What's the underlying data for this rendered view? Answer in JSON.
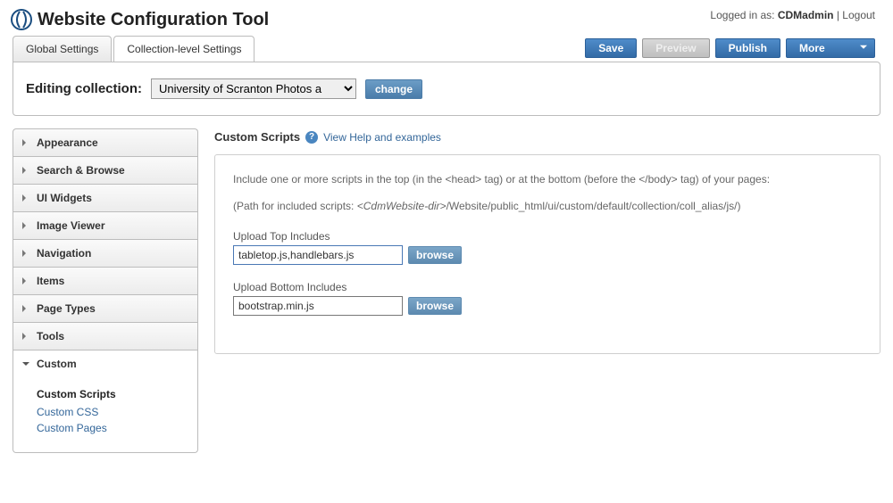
{
  "header": {
    "title": "Website Configuration Tool",
    "logged_in_prefix": "Logged in as: ",
    "username": "CDMadmin",
    "logout": "Logout"
  },
  "tabs": {
    "global": "Global Settings",
    "collection": "Collection-level Settings"
  },
  "actions": {
    "save": "Save",
    "preview": "Preview",
    "publish": "Publish",
    "more": "More"
  },
  "edit": {
    "label": "Editing collection:",
    "selected": "University of Scranton Photos a",
    "change": "change"
  },
  "sidebar": {
    "items": [
      "Appearance",
      "Search & Browse",
      "UI Widgets",
      "Image Viewer",
      "Navigation",
      "Items",
      "Page Types",
      "Tools",
      "Custom"
    ],
    "custom": {
      "scripts": "Custom Scripts",
      "css": "Custom CSS",
      "pages": "Custom Pages"
    }
  },
  "main": {
    "title": "Custom Scripts",
    "help": "View Help and examples",
    "intro_a": "Include one or more scripts in the top (in the <head> tag) or at the bottom (before the </body> tag) of your pages:",
    "path_prefix": "(Path for included scripts: ",
    "path_ital": "<CdmWebsite-dir>",
    "path_suffix": "/Website/public_html/ui/custom/default/collection/coll_alias/js/)",
    "top_label": "Upload Top Includes",
    "top_value": "tabletop.js,handlebars.js",
    "bottom_label": "Upload Bottom Includes",
    "bottom_value": "bootstrap.min.js",
    "browse": "browse"
  }
}
